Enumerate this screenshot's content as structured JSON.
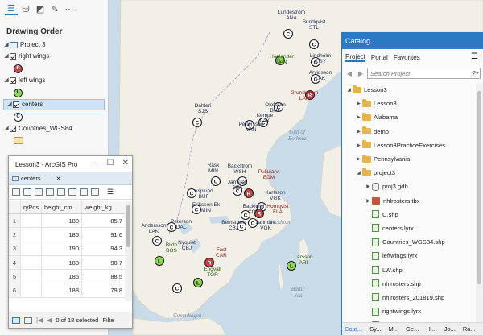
{
  "contents": {
    "section_title": "Drawing Order",
    "toolbar_icons": [
      "list-by-drawing-order-icon",
      "database-icon",
      "polygon-edit-icon",
      "pencil-icon",
      "more-icon"
    ],
    "tree": [
      {
        "label": "Project 3",
        "type": "map"
      },
      {
        "label": "right wings",
        "type": "layer",
        "symbol": "R",
        "symbol_color": "#c94545"
      },
      {
        "label": "left wings",
        "type": "layer",
        "symbol": "L",
        "symbol_color": "#8fd65a"
      },
      {
        "label": "centers",
        "type": "layer",
        "symbol": "C",
        "symbol_color": "#ffffff",
        "selected": true
      },
      {
        "label": "Countries_WGS84",
        "type": "layer"
      }
    ]
  },
  "table_window": {
    "title": "Lesson3 - ArcGIS Pro",
    "tab_label": "centers",
    "columns": [
      "ryPos",
      "height_cm",
      "weight_kg"
    ],
    "rows": [
      {
        "idx": "1",
        "pos": "",
        "height": "180",
        "weight": "85.7"
      },
      {
        "idx": "2",
        "pos": "",
        "height": "185",
        "weight": "91.6"
      },
      {
        "idx": "3",
        "pos": "",
        "height": "190",
        "weight": "94.3"
      },
      {
        "idx": "4",
        "pos": "",
        "height": "183",
        "weight": "90.7"
      },
      {
        "idx": "5",
        "pos": "",
        "height": "185",
        "weight": "88.5"
      },
      {
        "idx": "6",
        "pos": "",
        "height": "188",
        "weight": "79.8"
      }
    ],
    "footer": {
      "selection_text": "0 of 18 selected",
      "filter_label": "Filte"
    }
  },
  "catalog": {
    "title": "Catalog",
    "tabs": [
      "Project",
      "Portal",
      "Favorites"
    ],
    "search_placeholder": "Search Project",
    "items": [
      {
        "label": "Lesson3",
        "kind": "folder",
        "indent": 0,
        "arrow": "down"
      },
      {
        "label": "Lesson3",
        "kind": "folder-home",
        "indent": 1,
        "arrow": "right"
      },
      {
        "label": "Alabama",
        "kind": "folder",
        "indent": 1,
        "arrow": "right"
      },
      {
        "label": "demo",
        "kind": "folder",
        "indent": 1,
        "arrow": "right"
      },
      {
        "label": "Lesson3PracticeExercises",
        "kind": "folder",
        "indent": 1,
        "arrow": "right"
      },
      {
        "label": "Pennsylvania",
        "kind": "folder",
        "indent": 1,
        "arrow": "right"
      },
      {
        "label": "project3",
        "kind": "folder",
        "indent": 1,
        "arrow": "down"
      },
      {
        "label": "proj3.gdb",
        "kind": "gdb",
        "indent": 2,
        "arrow": "right"
      },
      {
        "label": "nhlrosters.tbx",
        "kind": "tbx",
        "indent": 2,
        "arrow": "right"
      },
      {
        "label": "C.shp",
        "kind": "file",
        "indent": 2,
        "arrow": ""
      },
      {
        "label": "centers.lyrx",
        "kind": "file",
        "indent": 2,
        "arrow": ""
      },
      {
        "label": "Countries_WGS84.shp",
        "kind": "file",
        "indent": 2,
        "arrow": ""
      },
      {
        "label": "leftwings.lyrx",
        "kind": "file",
        "indent": 2,
        "arrow": ""
      },
      {
        "label": "LW.shp",
        "kind": "file",
        "indent": 2,
        "arrow": ""
      },
      {
        "label": "nhlrosters.shp",
        "kind": "file",
        "indent": 2,
        "arrow": ""
      },
      {
        "label": "nhlrosters_201819.shp",
        "kind": "file",
        "indent": 2,
        "arrow": ""
      },
      {
        "label": "rightwings.lyrx",
        "kind": "file",
        "indent": 2,
        "arrow": ""
      },
      {
        "label": "RW.shp",
        "kind": "file",
        "indent": 2,
        "arrow": ""
      }
    ],
    "bottom_tabs": [
      "Cata...",
      "Sy...",
      "M...",
      "Ge...",
      "Hi...",
      "Jo...",
      "Ra..."
    ]
  },
  "map": {
    "water_labels": [
      "Gulf of\nBothnia",
      "Stockholm",
      "Baltic\nSea",
      "Copenhagen"
    ],
    "markers": [
      {
        "t": "C",
        "name": "Lundestrom\nANA"
      },
      {
        "t": "C",
        "name": "Sundqvist\nSTL"
      },
      {
        "t": "C",
        "name": "Lindholm\nCGY"
      },
      {
        "t": "L",
        "name": "Hoglander\nVAN"
      },
      {
        "t": "C",
        "name": "Arvidsson\nLAK"
      },
      {
        "t": "R",
        "name": "Grundstrom\nLAK"
      },
      {
        "t": "C",
        "name": "Olofsson\nBUF"
      },
      {
        "t": "C",
        "name": "Kempe\nLAK"
      },
      {
        "t": "C",
        "name": "Pettersson\nVAN"
      },
      {
        "t": "C",
        "name": "Dahlen\nSJS"
      },
      {
        "t": "C",
        "name": "Rask\nMIN"
      },
      {
        "t": "C",
        "name": "Backstrom\nWSH"
      },
      {
        "t": "R",
        "name": "Puljujarvi\nEDM"
      },
      {
        "t": "C",
        "name": "Jamkrok\nSEA"
      },
      {
        "t": "C",
        "name": "Asplund\nBUF"
      },
      {
        "t": "C",
        "name": "Eriksson Ek\nMIN"
      },
      {
        "t": "C",
        "name": "Karlsson\nVGK"
      },
      {
        "t": "R",
        "name": "Hornqvist\nFLA"
      },
      {
        "t": "C",
        "name": "Backlund\nCGY"
      },
      {
        "t": "C",
        "name": "Janmark\nVGK"
      },
      {
        "t": "C",
        "name": "Bemstrom\nCBJ"
      },
      {
        "t": "C",
        "name": "Peterson\nDAL"
      },
      {
        "t": "C",
        "name": "Andersson\nLAK"
      },
      {
        "t": "L",
        "name": "Blidh\nBOS"
      },
      {
        "t": "R",
        "name": "Fast\nCAR"
      },
      {
        "t": "C",
        "name": "Nyquist\nCBJ"
      },
      {
        "t": "L",
        "name": "Engvall\nTOR"
      },
      {
        "t": "L",
        "name": "Larsson\nARI"
      }
    ],
    "colors": {
      "C": "#ffffff",
      "L": "#8fd65a",
      "R": "#c94545",
      "land": "#f2efe6",
      "water": "#c9dbe8"
    }
  }
}
